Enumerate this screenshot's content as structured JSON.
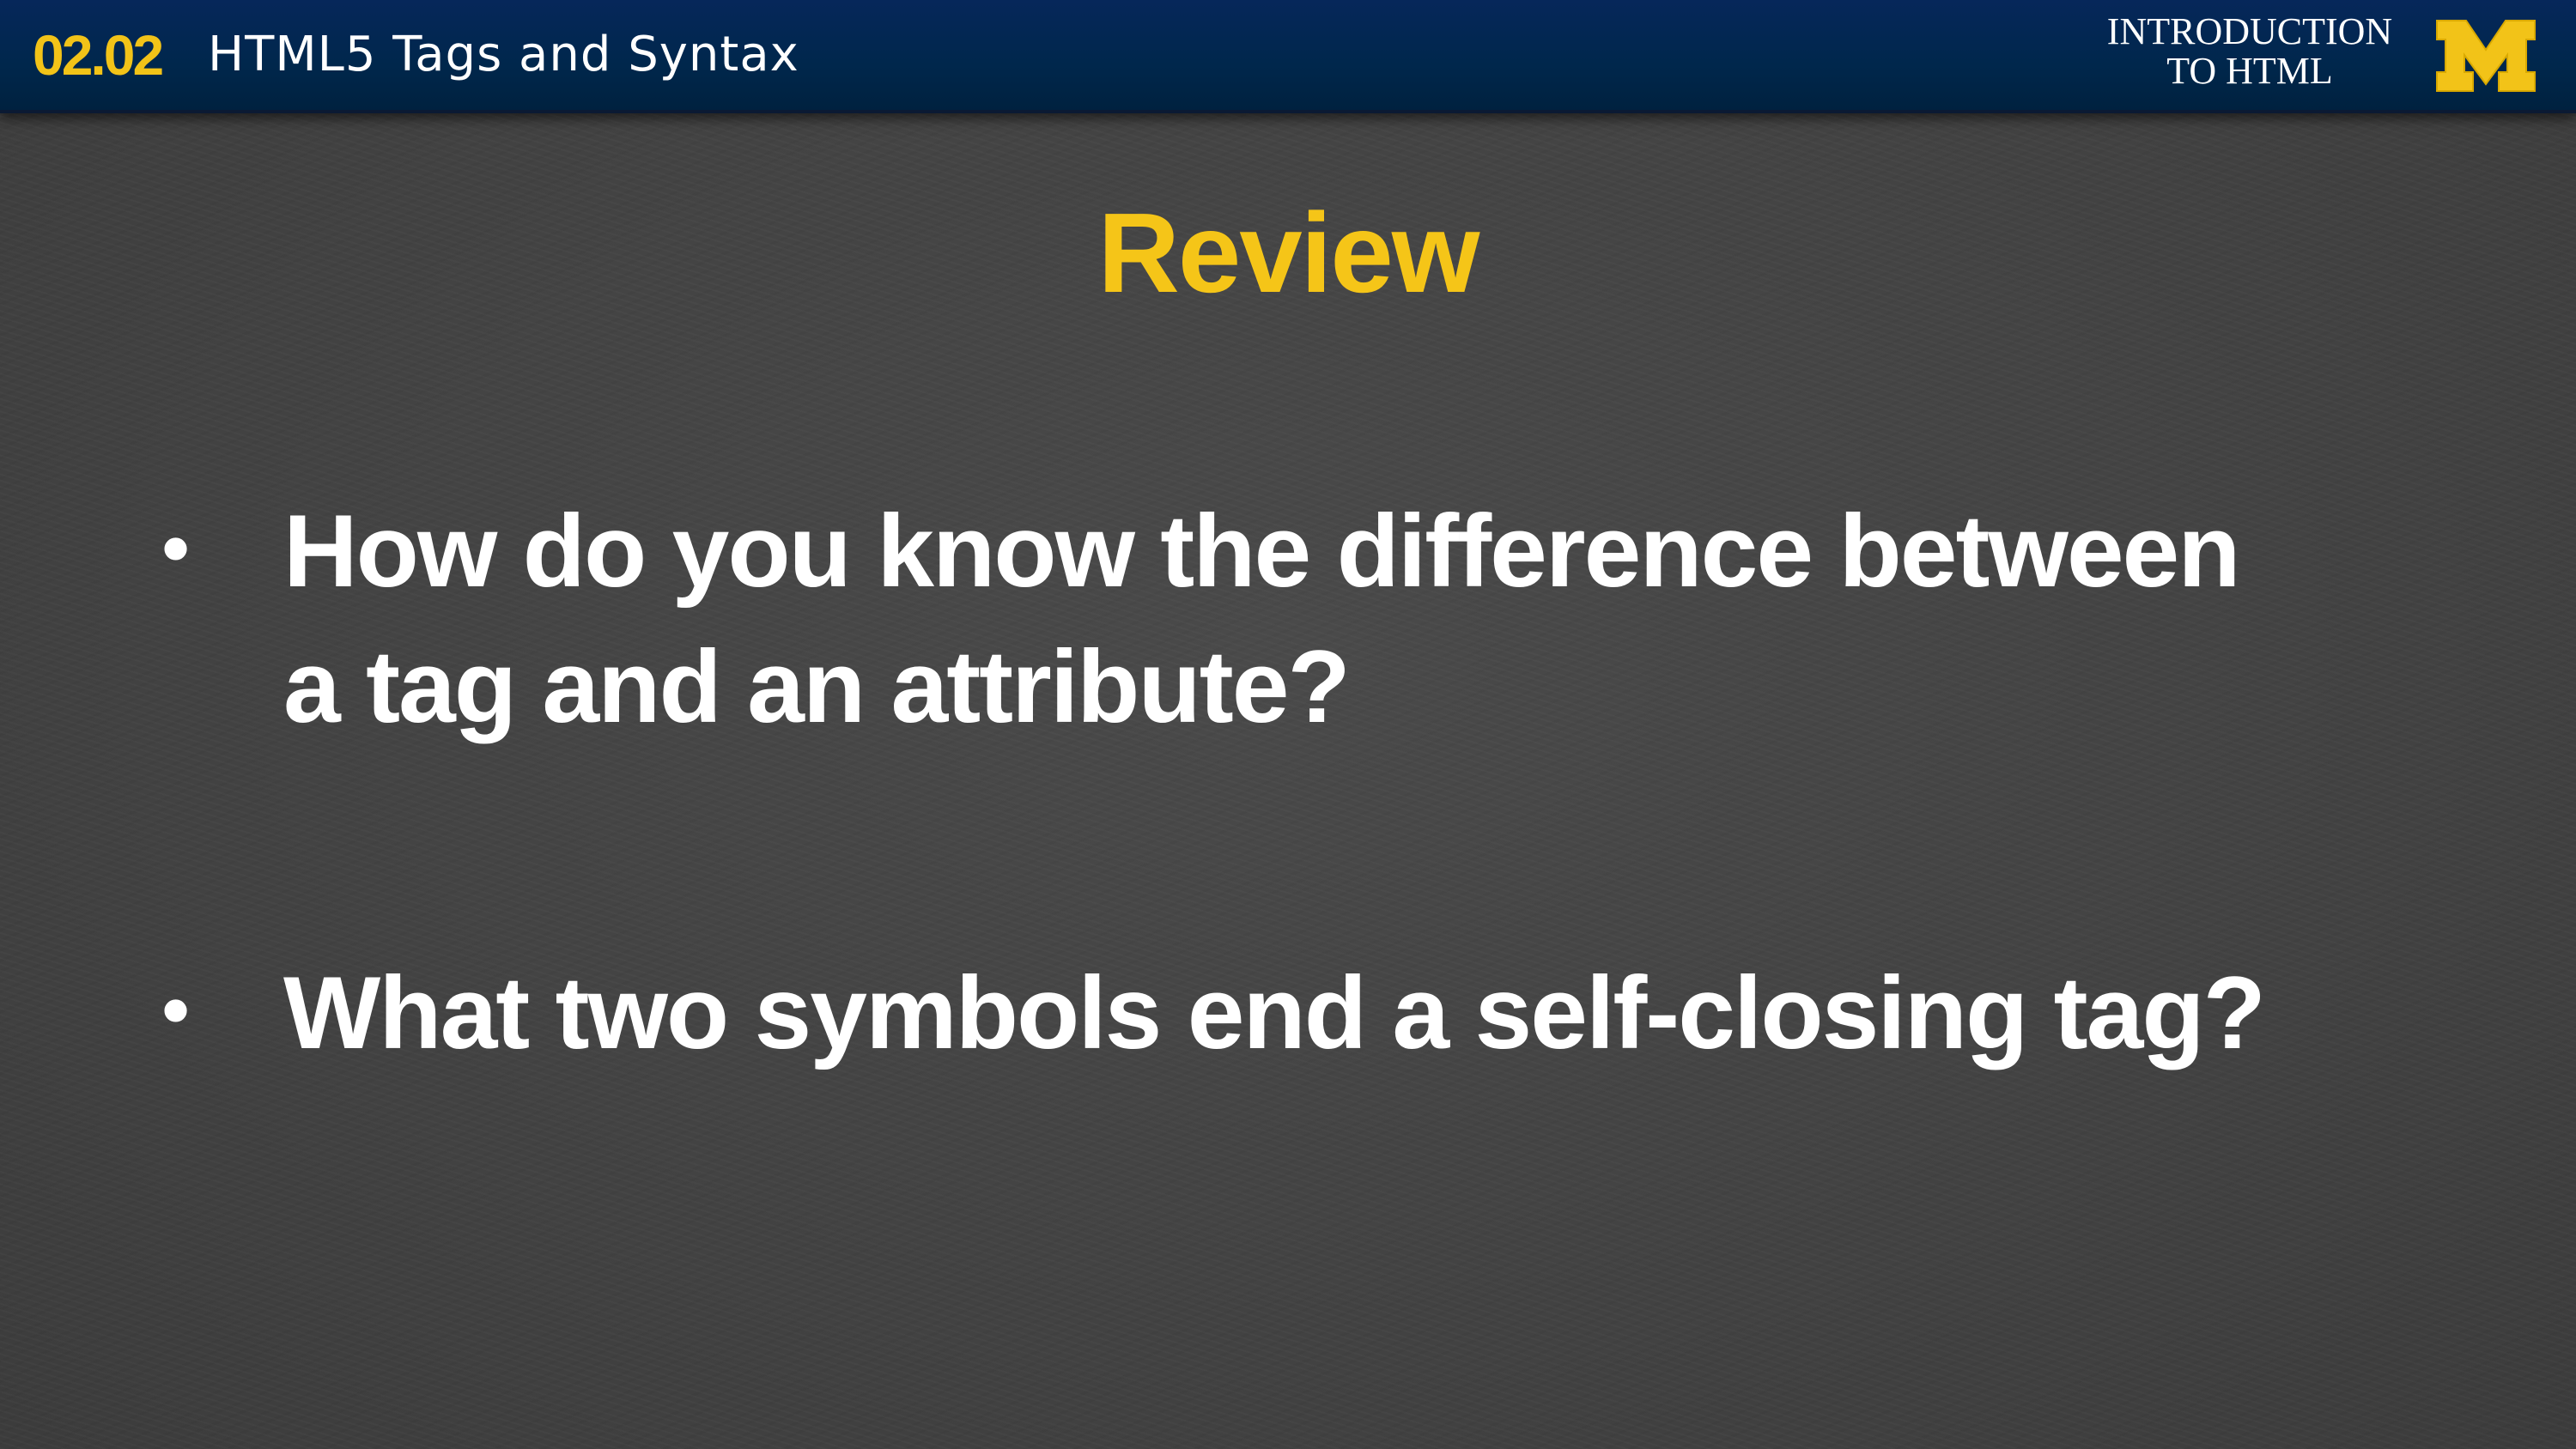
{
  "header": {
    "lesson_number": "02.02",
    "lesson_title": "HTML5 Tags and Syntax",
    "course_line1": "INTRODUCTION",
    "course_line2": "TO HTML",
    "logo_icon": "block-m-logo-icon",
    "colors": {
      "bar": "#00274c",
      "maize": "#f2c318"
    }
  },
  "slide": {
    "title": "Review",
    "bullets": [
      {
        "line1": "How do you know the difference between",
        "line2": "a tag and an attribute?"
      },
      {
        "line1": "What two symbols end a self-closing tag?"
      }
    ],
    "bullet_glyph": "•",
    "colors": {
      "background": "#444444",
      "title": "#f5c518",
      "text": "#ffffff"
    }
  }
}
